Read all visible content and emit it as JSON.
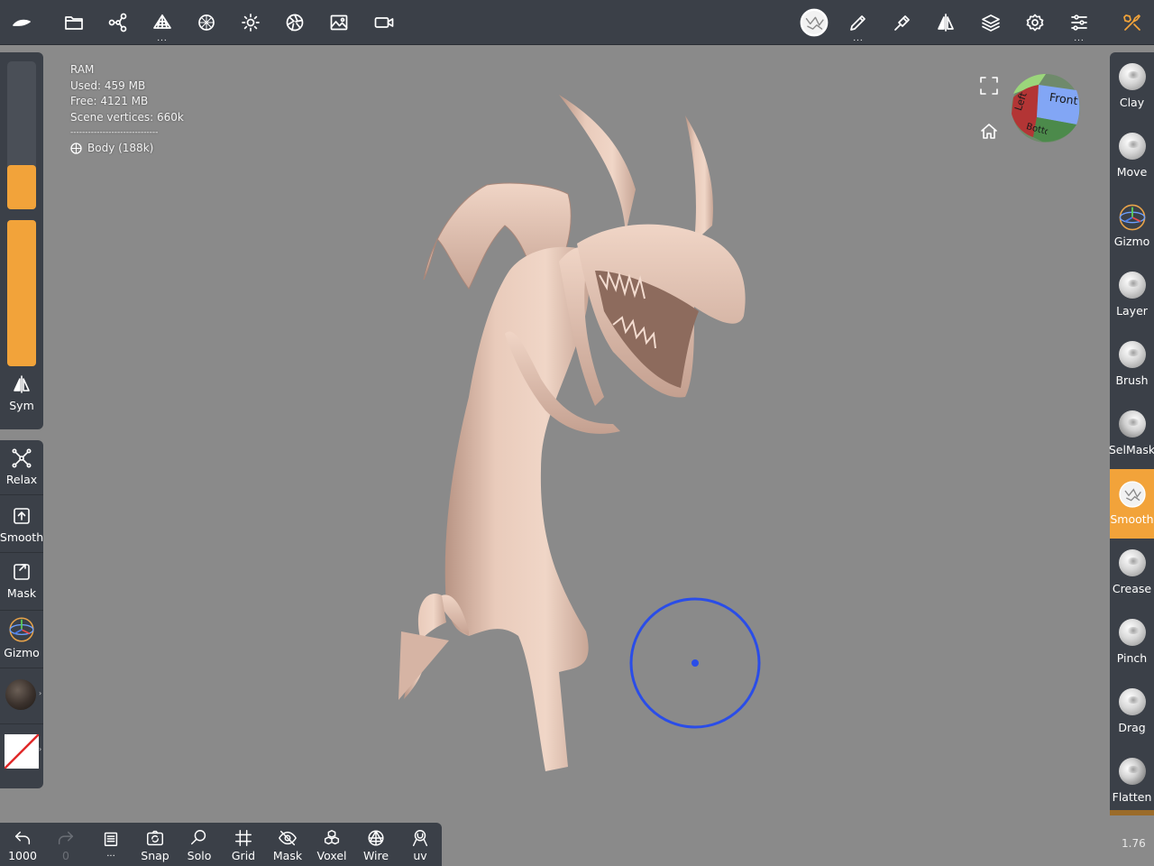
{
  "top_toolbar": {
    "icons": [
      "logo-icon",
      "folder-icon",
      "scene-graph-icon",
      "topology-icon",
      "material-icon",
      "light-icon",
      "camera-aperture-icon",
      "image-icon",
      "video-icon"
    ],
    "right_icons": [
      "smooth-brush-icon",
      "pencil-icon",
      "brush-settings-icon",
      "symmetry-icon",
      "layers-icon",
      "settings-icon",
      "sliders-icon",
      "tools-icon"
    ],
    "tools_icon_color": "#f2a33a"
  },
  "info": {
    "ram": "RAM",
    "used": "Used: 459 MB",
    "free": "Free: 4121 MB",
    "vertices": "Scene vertices: 660k",
    "divider": "------------------------------",
    "body": "Body  (188k)"
  },
  "left_panel": {
    "slider_top_fill_percent": 30,
    "slider_bottom_fill_percent": 100,
    "sym_label": "Sym",
    "items": [
      {
        "label": "Relax"
      },
      {
        "label": "Smooth"
      },
      {
        "label": "Mask"
      },
      {
        "label": "Gizmo"
      }
    ]
  },
  "right_tools": [
    {
      "label": "Clay"
    },
    {
      "label": "Move"
    },
    {
      "label": "Gizmo"
    },
    {
      "label": "Layer"
    },
    {
      "label": "Brush"
    },
    {
      "label": "SelMask"
    },
    {
      "label": "Smooth",
      "active": true
    },
    {
      "label": "Crease"
    },
    {
      "label": "Pinch"
    },
    {
      "label": "Drag"
    },
    {
      "label": "Flatten"
    }
  ],
  "view_cube": {
    "front": "Front",
    "left": "Left",
    "bottom": "Bottom"
  },
  "bottom_bar": {
    "undo": "1000",
    "redo": "0",
    "menu": "...",
    "snap": "Snap",
    "solo": "Solo",
    "grid": "Grid",
    "mask": "Mask",
    "voxel": "Voxel",
    "wire": "Wire",
    "uv": "uv"
  },
  "version": "1.76",
  "colors": {
    "accent": "#f2a33a",
    "panel": "#3b4048",
    "viewport": "#8a8a8a",
    "brush_cursor": "#2a4de8",
    "model": "#e8c9b8"
  }
}
